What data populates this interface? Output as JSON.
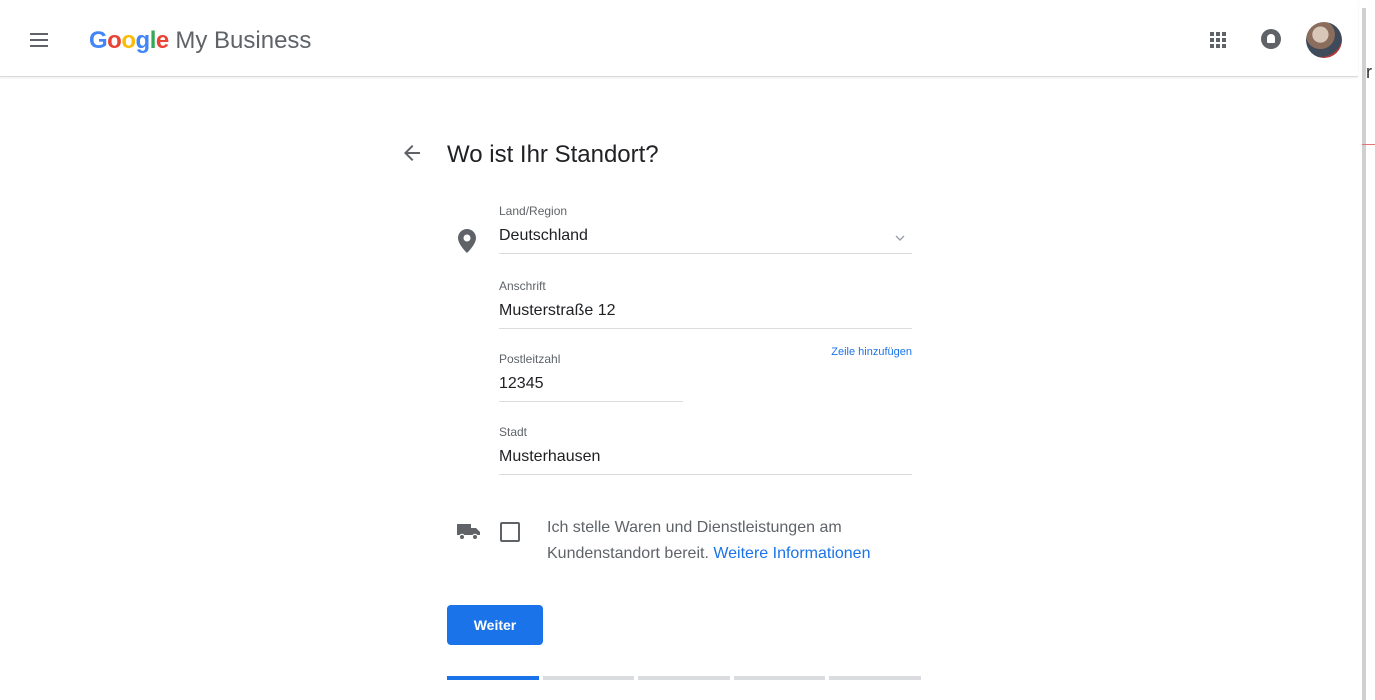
{
  "header": {
    "brand_google": "Google",
    "brand_product": "My Business",
    "brand_colors": [
      "#4285F4",
      "#EA4335",
      "#FBBC05",
      "#4285F4",
      "#34A853",
      "#EA4335"
    ],
    "icons": [
      "menu-icon",
      "apps-grid-icon",
      "notifications-icon",
      "avatar"
    ]
  },
  "edge_text": "r",
  "page": {
    "title": "Wo ist Ihr Standort?"
  },
  "form": {
    "country": {
      "label": "Land/Region",
      "value": "Deutschland"
    },
    "address": {
      "label": "Anschrift",
      "value": "Musterstraße 12"
    },
    "add_line": "Zeile hinzufügen",
    "postal": {
      "label": "Postleitzahl",
      "value": "12345"
    },
    "city": {
      "label": "Stadt",
      "value": "Musterhausen"
    },
    "delivery": {
      "checked": false,
      "text": "Ich stelle Waren und Dienstleistungen am Kundenstandort bereit.",
      "link": "Weitere Informationen"
    },
    "next_label": "Weiter"
  },
  "progress": {
    "segments": 5,
    "current": 1
  },
  "colors": {
    "accent": "#1a73e8",
    "text": "#202124",
    "muted": "#5f6368",
    "divider": "#dadce0"
  }
}
